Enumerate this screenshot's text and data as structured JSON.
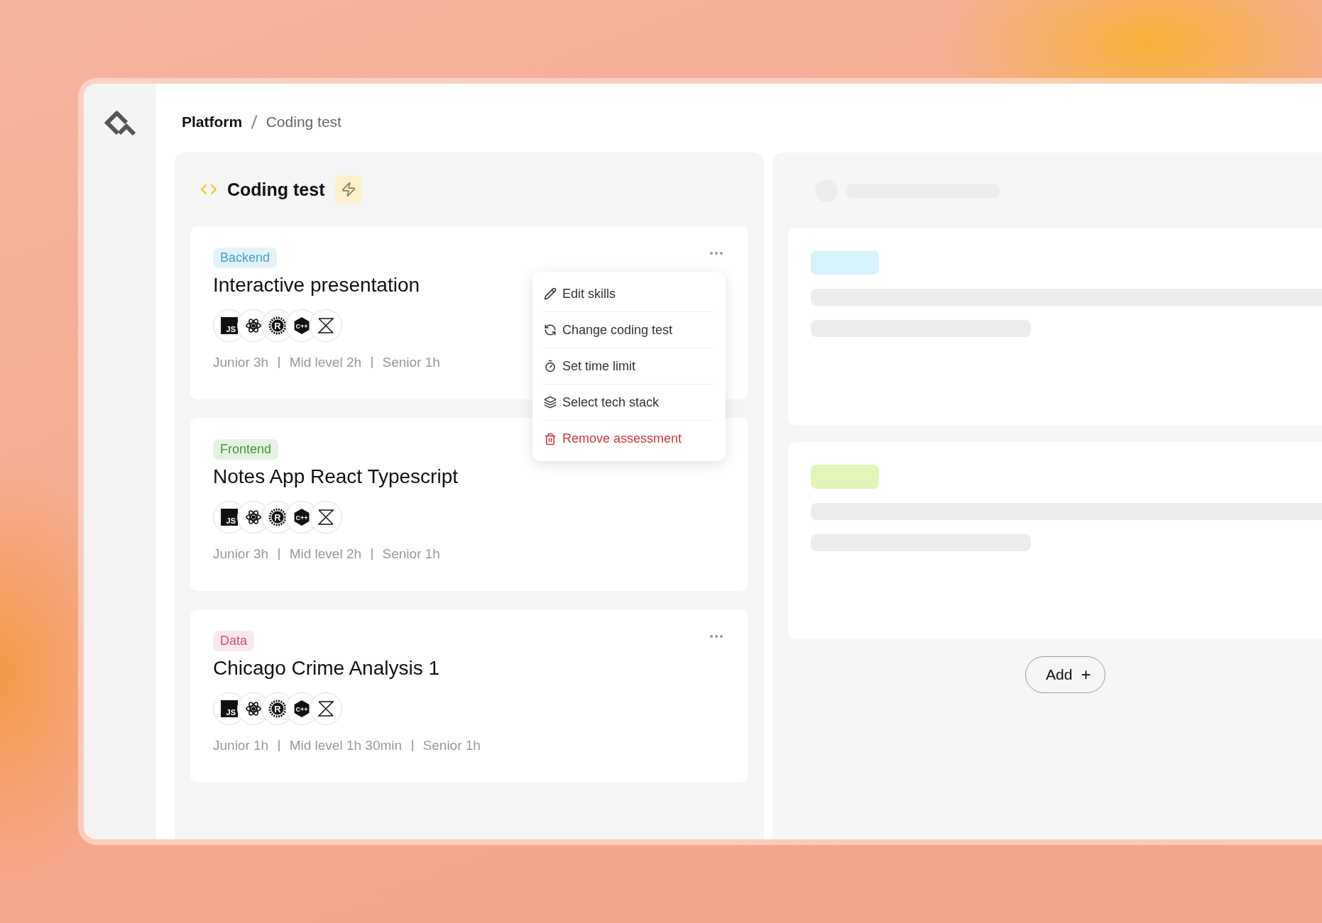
{
  "breadcrumb": [
    {
      "label": "Platform",
      "current": false
    },
    {
      "label": "Coding test",
      "current": true
    }
  ],
  "panel": {
    "title": "Coding test"
  },
  "cards": [
    {
      "tag": {
        "label": "Backend",
        "color": "#3aa6d0"
      },
      "title": "Interactive presentation",
      "tech": [
        {
          "kind": "js",
          "text": "JS"
        },
        {
          "kind": "react"
        },
        {
          "kind": "rust",
          "text": "R"
        },
        {
          "kind": "cpp",
          "text": "C++"
        },
        {
          "kind": "zig"
        }
      ],
      "durations": [
        "Junior 3h",
        "Mid level 2h",
        "Senior 1h"
      ],
      "menu_open": true
    },
    {
      "tag": {
        "label": "Frontend",
        "color": "#3c9a2c"
      },
      "title": "Notes App React Typescript",
      "tech": [
        {
          "kind": "js",
          "text": "JS"
        },
        {
          "kind": "react"
        },
        {
          "kind": "rust",
          "text": "R"
        },
        {
          "kind": "cpp",
          "text": "C++"
        },
        {
          "kind": "zig"
        }
      ],
      "durations": [
        "Junior 3h",
        "Mid level 2h",
        "Senior 1h"
      ],
      "menu_open": false
    },
    {
      "tag": {
        "label": "Data",
        "color": "#d0507a"
      },
      "title": "Chicago Crime Analysis 1",
      "tech": [
        {
          "kind": "js",
          "text": "JS"
        },
        {
          "kind": "react"
        },
        {
          "kind": "rust",
          "text": "R"
        },
        {
          "kind": "cpp",
          "text": "C++"
        },
        {
          "kind": "zig"
        }
      ],
      "durations": [
        "Junior 1h",
        "Mid level 1h 30min",
        "Senior 1h"
      ],
      "menu_open": false
    }
  ],
  "menu": [
    {
      "label": "Edit skills",
      "kind": "normal"
    },
    {
      "label": "Change coding test",
      "kind": "normal"
    },
    {
      "label": "Set time limit",
      "kind": "normal"
    },
    {
      "label": "Select tech stack",
      "kind": "normal"
    },
    {
      "label": "Remove assessment",
      "kind": "danger"
    }
  ],
  "add_button": {
    "label": "Add",
    "symbol": "+"
  }
}
